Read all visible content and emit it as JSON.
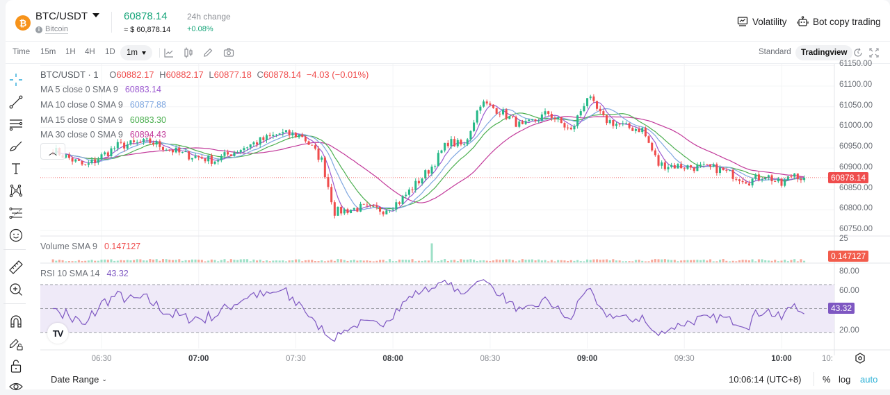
{
  "header": {
    "pair": "BTC/USDT",
    "coin_name": "Bitcoin",
    "coin_symbol": "₿",
    "last_price": "60878.14",
    "usd_price": "≈ $ 60,878.14",
    "change_label": "24h change",
    "change_value": "+0.08%",
    "volatility_label": "Volatility",
    "bot_label": "Bot copy trading"
  },
  "toolbar": {
    "intervals": [
      "Time",
      "15m",
      "1H",
      "4H",
      "1D"
    ],
    "selected_interval": "1m",
    "view_standard": "Standard",
    "view_tradingview": "Tradingview"
  },
  "legend": {
    "symbol": "BTC/USDT · 1",
    "o_label": "O",
    "o": "60882.17",
    "h_label": "H",
    "h": "60882.17",
    "l_label": "L",
    "l": "60877.18",
    "c_label": "C",
    "c": "60878.14",
    "change": "−4.03 (−0.01%)",
    "ma": [
      {
        "label": "MA 5 close 0 SMA 9",
        "value": "60883.14",
        "color": "#9b59d0"
      },
      {
        "label": "MA 10 close 0 SMA 9",
        "value": "60877.88",
        "color": "#7fa7e0"
      },
      {
        "label": "MA 15 close 0 SMA 9",
        "value": "60883.30",
        "color": "#4caf50"
      },
      {
        "label": "MA 30 close 0 SMA 9",
        "value": "60894.43",
        "color": "#c2399a"
      }
    ],
    "volume_label": "Volume SMA 9",
    "volume_value": "0.147127",
    "rsi_label": "RSI 10 SMA 14",
    "rsi_value": "43.32"
  },
  "price_axis": [
    "61150.00",
    "61100.00",
    "61050.00",
    "61000.00",
    "60950.00",
    "60900.00",
    "60850.00",
    "60800.00",
    "60750.00"
  ],
  "last_price_tag": "60878.14",
  "volume_axis": "25",
  "volume_tag": "0.147127",
  "rsi_axis": [
    "80.00",
    "60.00",
    "20.00"
  ],
  "rsi_tag": "43.32",
  "time_axis": [
    {
      "label": "06:30",
      "bold": false
    },
    {
      "label": "07:00",
      "bold": true
    },
    {
      "label": "07:30",
      "bold": false
    },
    {
      "label": "08:00",
      "bold": true
    },
    {
      "label": "08:30",
      "bold": false
    },
    {
      "label": "09:00",
      "bold": true
    },
    {
      "label": "09:30",
      "bold": false
    },
    {
      "label": "10:00",
      "bold": true
    },
    {
      "label": "10:",
      "bold": false
    }
  ],
  "footer": {
    "date_range": "Date Range",
    "clock": "10:06:14 (UTC+8)",
    "percent": "%",
    "log": "log",
    "auto": "auto"
  },
  "colors": {
    "up": "#26b888",
    "down": "#ef4c4c",
    "rsi": "#7e57c2",
    "accent": "#17a57a",
    "auto": "#2ab0d6"
  },
  "chart_data": {
    "type": "candlestick",
    "title": "BTC/USDT · 1",
    "xlabel": "",
    "ylabel": "",
    "ylim": [
      60720,
      61160
    ],
    "x_range": [
      "06:15",
      "10:07"
    ],
    "closes_anchor": [
      [
        "06:15",
        60945
      ],
      [
        "06:25",
        60905
      ],
      [
        "06:35",
        60955
      ],
      [
        "06:45",
        60965
      ],
      [
        "06:55",
        60935
      ],
      [
        "07:05",
        60920
      ],
      [
        "07:15",
        60955
      ],
      [
        "07:25",
        60985
      ],
      [
        "07:32",
        60980
      ],
      [
        "07:38",
        60920
      ],
      [
        "07:42",
        60795
      ],
      [
        "07:50",
        60805
      ],
      [
        "07:57",
        60800
      ],
      [
        "08:02",
        60820
      ],
      [
        "08:08",
        60870
      ],
      [
        "08:12",
        60905
      ],
      [
        "08:17",
        60965
      ],
      [
        "08:22",
        60955
      ],
      [
        "08:27",
        61060
      ],
      [
        "08:33",
        61040
      ],
      [
        "08:40",
        61000
      ],
      [
        "08:48",
        61035
      ],
      [
        "08:55",
        60990
      ],
      [
        "09:00",
        61075
      ],
      [
        "09:05",
        61020
      ],
      [
        "09:12",
        61000
      ],
      [
        "09:17",
        60995
      ],
      [
        "09:22",
        60910
      ],
      [
        "09:30",
        60905
      ],
      [
        "09:40",
        60900
      ],
      [
        "09:50",
        60870
      ],
      [
        "09:55",
        60885
      ],
      [
        "10:00",
        60860
      ],
      [
        "10:04",
        60890
      ],
      [
        "10:06",
        60878.14
      ]
    ],
    "rsi_ylim": [
      0,
      100
    ],
    "rsi_levels": [
      80,
      50,
      20
    ],
    "rsi_last": 43.32,
    "volume_last": 0.147127
  }
}
